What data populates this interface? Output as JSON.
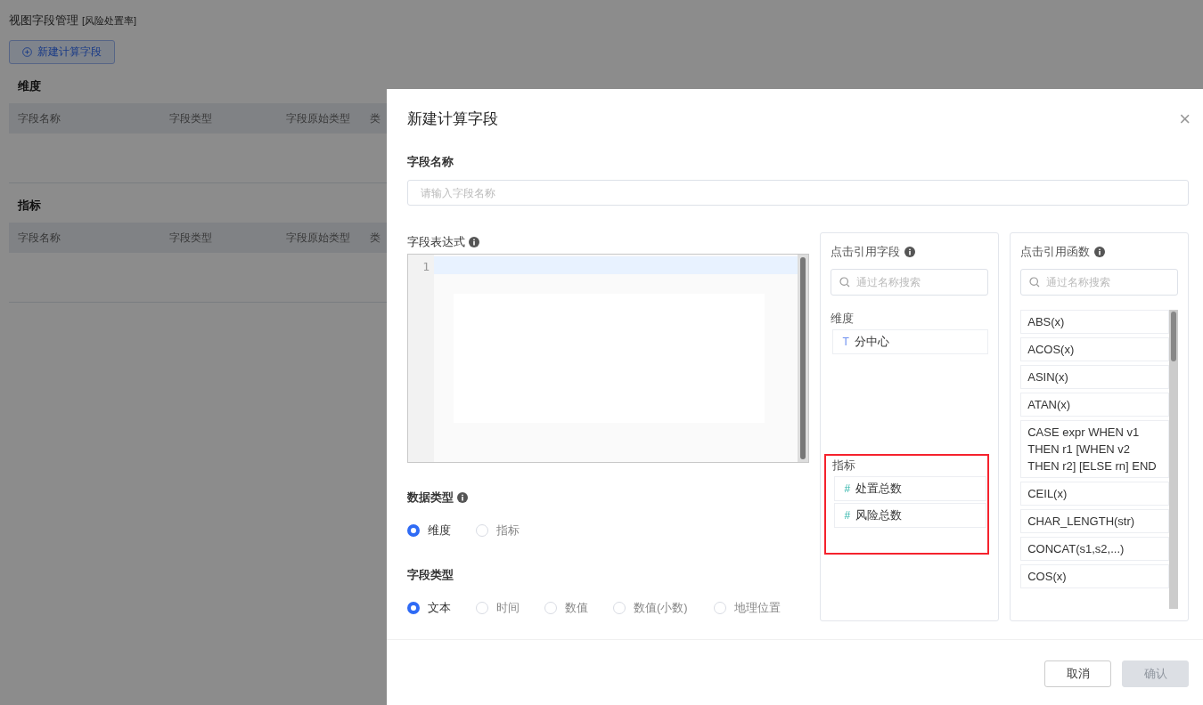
{
  "page": {
    "title": "视图字段管理",
    "subtitle": "[风险处置率]",
    "new_button": "新建计算字段",
    "sections": [
      {
        "title": "维度",
        "columns": [
          "字段名称",
          "字段类型",
          "字段原始类型",
          "类"
        ]
      },
      {
        "title": "指标",
        "columns": [
          "字段名称",
          "字段类型",
          "字段原始类型",
          "类"
        ]
      }
    ]
  },
  "drawer": {
    "title": "新建计算字段",
    "close": "×",
    "name_field": {
      "label": "字段名称",
      "placeholder": "请输入字段名称"
    },
    "expression": {
      "label": "字段表达式",
      "line_numbers": [
        "1"
      ]
    },
    "data_type": {
      "label": "数据类型",
      "options": [
        {
          "label": "维度",
          "selected": true
        },
        {
          "label": "指标",
          "selected": false
        }
      ]
    },
    "field_type": {
      "label": "字段类型",
      "options": [
        {
          "label": "文本",
          "selected": true
        },
        {
          "label": "时间",
          "selected": false
        },
        {
          "label": "数值",
          "selected": false
        },
        {
          "label": "数值(小数)",
          "selected": false
        },
        {
          "label": "地理位置",
          "selected": false
        }
      ]
    },
    "fields_panel": {
      "title": "点击引用字段",
      "search_placeholder": "通过名称搜索",
      "groups": [
        {
          "title": "维度",
          "highlighted": false,
          "items": [
            {
              "kind": "text",
              "icon": "T",
              "label": "分中心"
            }
          ]
        },
        {
          "title": "指标",
          "highlighted": true,
          "items": [
            {
              "kind": "number",
              "icon": "#",
              "label": "处置总数"
            },
            {
              "kind": "number",
              "icon": "#",
              "label": "风险总数"
            }
          ]
        }
      ]
    },
    "functions_panel": {
      "title": "点击引用函数",
      "search_placeholder": "通过名称搜索",
      "items": [
        "ABS(x)",
        "ACOS(x)",
        "ASIN(x)",
        "ATAN(x)",
        "CASE expr WHEN v1 THEN r1 [WHEN v2 THEN r2] [ELSE rn] END",
        "CEIL(x)",
        "CHAR_LENGTH(str)",
        "CONCAT(s1,s2,...)",
        "COS(x)"
      ]
    },
    "buttons": [
      {
        "label": "取消",
        "kind": "default",
        "disabled": false
      },
      {
        "label": "确认",
        "kind": "primary",
        "disabled": true
      }
    ]
  }
}
